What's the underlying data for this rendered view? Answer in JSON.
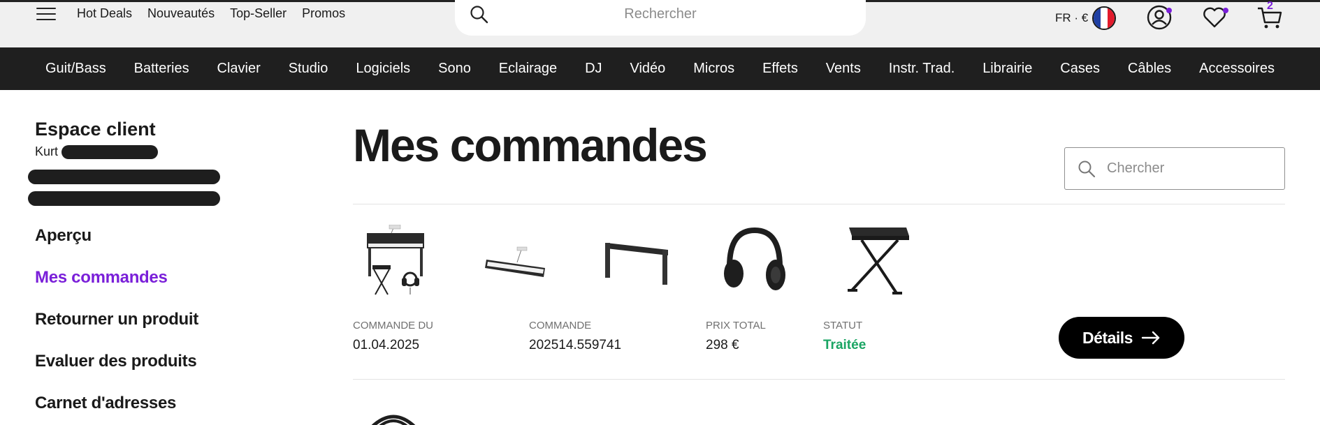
{
  "header": {
    "top_links": [
      "Hot Deals",
      "Nouveautés",
      "Top-Seller",
      "Promos"
    ],
    "search_placeholder": "Rechercher",
    "lang_currency": "FR · €",
    "cart_count": "2",
    "accent_color": "#7a1fd9"
  },
  "categories": [
    "Guit/Bass",
    "Batteries",
    "Clavier",
    "Studio",
    "Logiciels",
    "Sono",
    "Eclairage",
    "DJ",
    "Vidéo",
    "Micros",
    "Effets",
    "Vents",
    "Instr. Trad.",
    "Librairie",
    "Cases",
    "Câbles",
    "Accessoires"
  ],
  "sidebar": {
    "title": "Espace client",
    "user_first_name": "Kurt",
    "menu": [
      "Aperçu",
      "Mes commandes",
      "Retourner un produit",
      "Evaluer des produits",
      "Carnet d'adresses"
    ],
    "active_item": "Mes commandes"
  },
  "main": {
    "title": "Mes commandes",
    "search_placeholder": "Chercher",
    "order": {
      "thumbnails": [
        "digital-piano-set-icon",
        "keyboard-icon",
        "keyboard-stand-icon",
        "headphones-icon",
        "keyboard-bench-icon"
      ],
      "date_label": "Commande du",
      "date_value": "01.04.2025",
      "order_label": "Commande",
      "order_value": "202514.559741",
      "total_label": "Prix total",
      "total_value": "298 €",
      "status_label": "Statut",
      "status_value": "Traitée",
      "status_color": "#1aa563",
      "details_label": "Détails"
    }
  }
}
